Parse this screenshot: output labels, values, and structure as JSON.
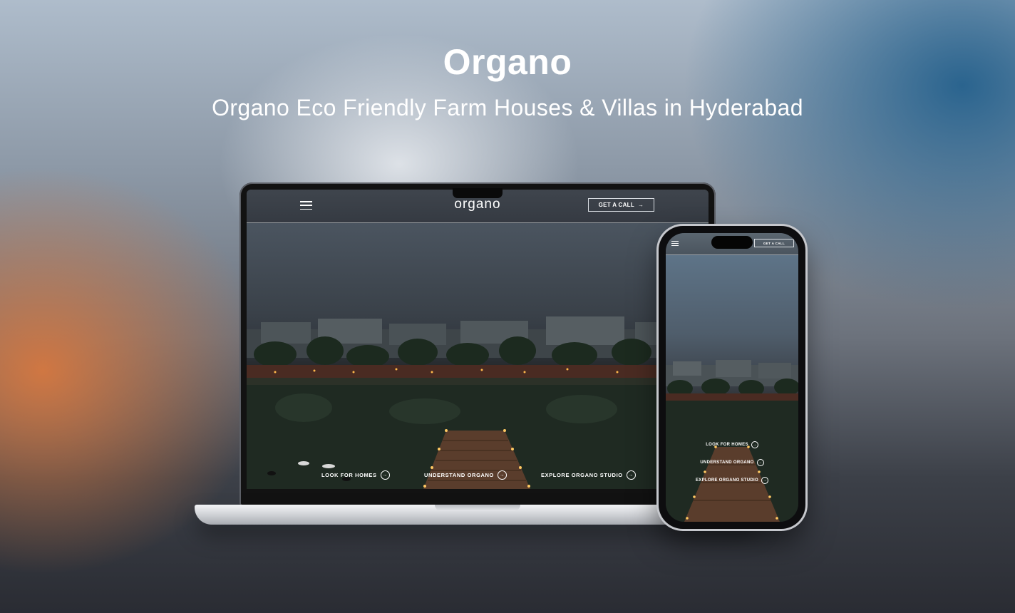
{
  "hero": {
    "title": "Organo",
    "subtitle": "Organo Eco Friendly Farm Houses & Villas in Hyderabad"
  },
  "site": {
    "logo": "organo",
    "call_button": "GET A CALL",
    "ctas": [
      {
        "label": "LOOK FOR HOMES",
        "icon": "arrow-right-circle-icon"
      },
      {
        "label": "UNDERSTAND ORGANO",
        "icon": "arrow-right-circle-icon"
      },
      {
        "label": "EXPLORE ORGANO STUDIO",
        "icon": "arrow-right-circle-icon"
      }
    ]
  },
  "glyphs": {
    "arrow": "→",
    "circle_arrow": "→"
  },
  "colors": {
    "accent": "#ffffff",
    "lights": "#ffb84a"
  }
}
